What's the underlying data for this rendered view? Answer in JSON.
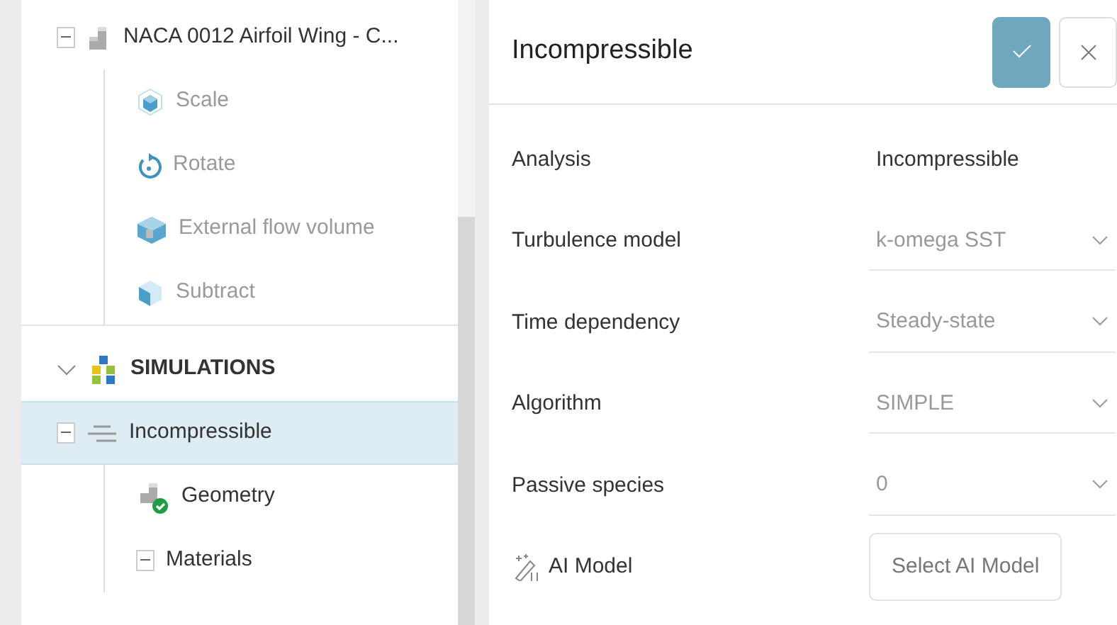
{
  "tree": [
    {
      "kind": "geometry",
      "label": "NACA 0012 Airfoil Wing - C...",
      "expanded": true,
      "selected": false,
      "disabled": false,
      "children": [
        {
          "kind": "scale",
          "label": "Scale",
          "selected": false,
          "disabled": true
        },
        {
          "kind": "rotate",
          "label": "Rotate",
          "selected": false,
          "disabled": true
        },
        {
          "kind": "flow-volume",
          "label": "External flow volume",
          "selected": false,
          "disabled": true
        },
        {
          "kind": "subtract",
          "label": "Subtract",
          "selected": false,
          "disabled": true
        }
      ]
    },
    {
      "kind": "section",
      "label": "SIMULATIONS",
      "expanded": true,
      "selected": false,
      "disabled": false,
      "children": [
        {
          "kind": "simulation",
          "label": "Incompressible",
          "expanded": true,
          "selected": true,
          "disabled": false,
          "children": [
            {
              "kind": "geometry-ok",
              "label": "Geometry",
              "selected": false,
              "disabled": false
            },
            {
              "kind": "folder",
              "label": "Materials",
              "expanded": true,
              "selected": false,
              "disabled": false
            }
          ]
        }
      ]
    }
  ],
  "panel": {
    "title": "Incompressible",
    "fields": [
      {
        "kind": "text",
        "label": "Analysis",
        "value": "Incompressible"
      },
      {
        "kind": "select",
        "label": "Turbulence model",
        "value": "k-omega SST"
      },
      {
        "kind": "select",
        "label": "Time dependency",
        "value": "Steady-state"
      },
      {
        "kind": "select",
        "label": "Algorithm",
        "value": "SIMPLE"
      },
      {
        "kind": "select",
        "label": "Passive species",
        "value": "0"
      },
      {
        "kind": "ai-button",
        "label": "AI Model",
        "value": "Select AI Model"
      }
    ]
  }
}
